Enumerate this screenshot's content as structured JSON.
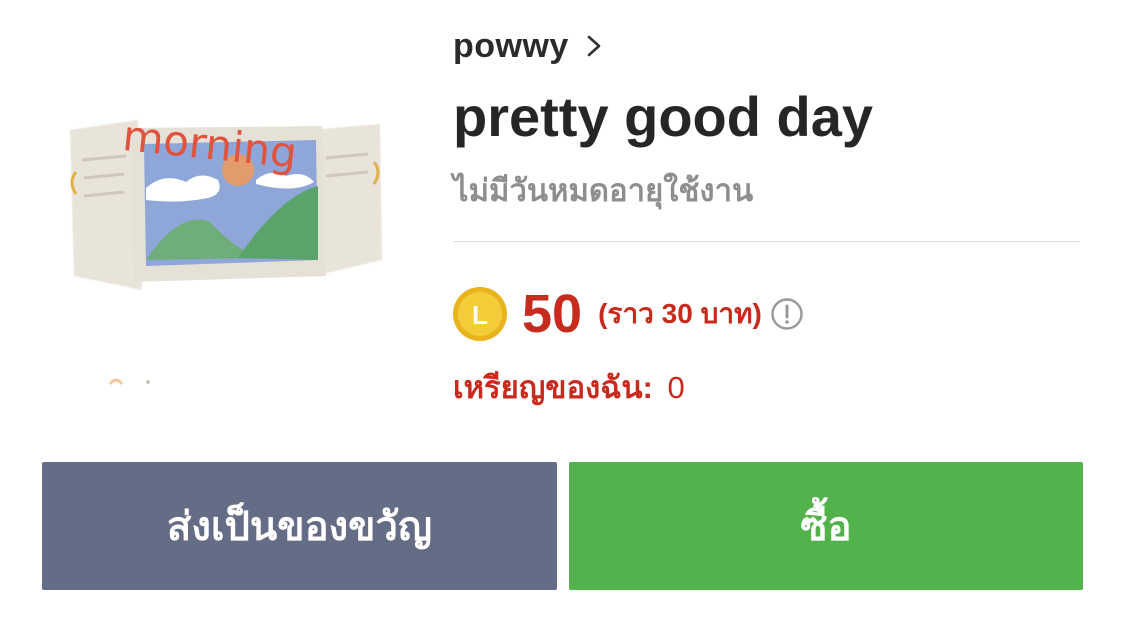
{
  "sticker": {
    "image_name": "sticker-thumbnail",
    "text": "morning"
  },
  "author": {
    "name": "powwy",
    "icon": "chevron-right-icon"
  },
  "title": "pretty good day",
  "validity": "ไม่มีวันหมดอายุใช้งาน",
  "price": {
    "coin_icon": "line-coin-icon",
    "coin_letter": "L",
    "value": "50",
    "approx": "(ราว  30 บาท)",
    "info_icon": "info-icon"
  },
  "my_coins": {
    "label": "เหรียญของฉัน:",
    "value": "0"
  },
  "buttons": {
    "gift_label": "ส่งเป็นของขวัญ",
    "buy_label": "ซื้อ"
  },
  "colors": {
    "price_red": "#c62b1d",
    "gift_button": "#656c85",
    "buy_button": "#52b34c",
    "coin_gold": "#f1c232"
  }
}
